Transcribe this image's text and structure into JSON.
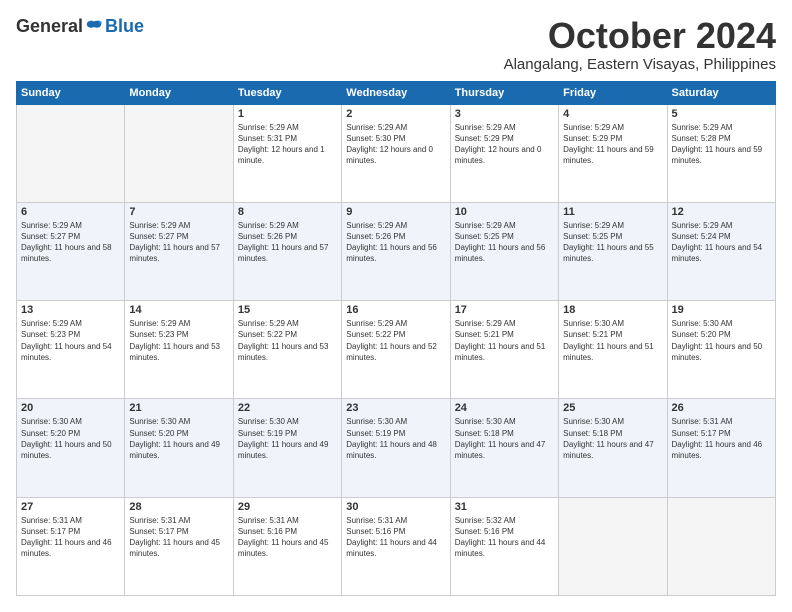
{
  "logo": {
    "general": "General",
    "blue": "Blue"
  },
  "header": {
    "month": "October 2024",
    "location": "Alangalang, Eastern Visayas, Philippines"
  },
  "weekdays": [
    "Sunday",
    "Monday",
    "Tuesday",
    "Wednesday",
    "Thursday",
    "Friday",
    "Saturday"
  ],
  "weeks": [
    [
      {
        "day": "",
        "empty": true
      },
      {
        "day": "",
        "empty": true
      },
      {
        "day": "1",
        "sunrise": "Sunrise: 5:29 AM",
        "sunset": "Sunset: 5:31 PM",
        "daylight": "Daylight: 12 hours and 1 minute."
      },
      {
        "day": "2",
        "sunrise": "Sunrise: 5:29 AM",
        "sunset": "Sunset: 5:30 PM",
        "daylight": "Daylight: 12 hours and 0 minutes."
      },
      {
        "day": "3",
        "sunrise": "Sunrise: 5:29 AM",
        "sunset": "Sunset: 5:29 PM",
        "daylight": "Daylight: 12 hours and 0 minutes."
      },
      {
        "day": "4",
        "sunrise": "Sunrise: 5:29 AM",
        "sunset": "Sunset: 5:29 PM",
        "daylight": "Daylight: 11 hours and 59 minutes."
      },
      {
        "day": "5",
        "sunrise": "Sunrise: 5:29 AM",
        "sunset": "Sunset: 5:28 PM",
        "daylight": "Daylight: 11 hours and 59 minutes."
      }
    ],
    [
      {
        "day": "6",
        "sunrise": "Sunrise: 5:29 AM",
        "sunset": "Sunset: 5:27 PM",
        "daylight": "Daylight: 11 hours and 58 minutes."
      },
      {
        "day": "7",
        "sunrise": "Sunrise: 5:29 AM",
        "sunset": "Sunset: 5:27 PM",
        "daylight": "Daylight: 11 hours and 57 minutes."
      },
      {
        "day": "8",
        "sunrise": "Sunrise: 5:29 AM",
        "sunset": "Sunset: 5:26 PM",
        "daylight": "Daylight: 11 hours and 57 minutes."
      },
      {
        "day": "9",
        "sunrise": "Sunrise: 5:29 AM",
        "sunset": "Sunset: 5:26 PM",
        "daylight": "Daylight: 11 hours and 56 minutes."
      },
      {
        "day": "10",
        "sunrise": "Sunrise: 5:29 AM",
        "sunset": "Sunset: 5:25 PM",
        "daylight": "Daylight: 11 hours and 56 minutes."
      },
      {
        "day": "11",
        "sunrise": "Sunrise: 5:29 AM",
        "sunset": "Sunset: 5:25 PM",
        "daylight": "Daylight: 11 hours and 55 minutes."
      },
      {
        "day": "12",
        "sunrise": "Sunrise: 5:29 AM",
        "sunset": "Sunset: 5:24 PM",
        "daylight": "Daylight: 11 hours and 54 minutes."
      }
    ],
    [
      {
        "day": "13",
        "sunrise": "Sunrise: 5:29 AM",
        "sunset": "Sunset: 5:23 PM",
        "daylight": "Daylight: 11 hours and 54 minutes."
      },
      {
        "day": "14",
        "sunrise": "Sunrise: 5:29 AM",
        "sunset": "Sunset: 5:23 PM",
        "daylight": "Daylight: 11 hours and 53 minutes."
      },
      {
        "day": "15",
        "sunrise": "Sunrise: 5:29 AM",
        "sunset": "Sunset: 5:22 PM",
        "daylight": "Daylight: 11 hours and 53 minutes."
      },
      {
        "day": "16",
        "sunrise": "Sunrise: 5:29 AM",
        "sunset": "Sunset: 5:22 PM",
        "daylight": "Daylight: 11 hours and 52 minutes."
      },
      {
        "day": "17",
        "sunrise": "Sunrise: 5:29 AM",
        "sunset": "Sunset: 5:21 PM",
        "daylight": "Daylight: 11 hours and 51 minutes."
      },
      {
        "day": "18",
        "sunrise": "Sunrise: 5:30 AM",
        "sunset": "Sunset: 5:21 PM",
        "daylight": "Daylight: 11 hours and 51 minutes."
      },
      {
        "day": "19",
        "sunrise": "Sunrise: 5:30 AM",
        "sunset": "Sunset: 5:20 PM",
        "daylight": "Daylight: 11 hours and 50 minutes."
      }
    ],
    [
      {
        "day": "20",
        "sunrise": "Sunrise: 5:30 AM",
        "sunset": "Sunset: 5:20 PM",
        "daylight": "Daylight: 11 hours and 50 minutes."
      },
      {
        "day": "21",
        "sunrise": "Sunrise: 5:30 AM",
        "sunset": "Sunset: 5:20 PM",
        "daylight": "Daylight: 11 hours and 49 minutes."
      },
      {
        "day": "22",
        "sunrise": "Sunrise: 5:30 AM",
        "sunset": "Sunset: 5:19 PM",
        "daylight": "Daylight: 11 hours and 49 minutes."
      },
      {
        "day": "23",
        "sunrise": "Sunrise: 5:30 AM",
        "sunset": "Sunset: 5:19 PM",
        "daylight": "Daylight: 11 hours and 48 minutes."
      },
      {
        "day": "24",
        "sunrise": "Sunrise: 5:30 AM",
        "sunset": "Sunset: 5:18 PM",
        "daylight": "Daylight: 11 hours and 47 minutes."
      },
      {
        "day": "25",
        "sunrise": "Sunrise: 5:30 AM",
        "sunset": "Sunset: 5:18 PM",
        "daylight": "Daylight: 11 hours and 47 minutes."
      },
      {
        "day": "26",
        "sunrise": "Sunrise: 5:31 AM",
        "sunset": "Sunset: 5:17 PM",
        "daylight": "Daylight: 11 hours and 46 minutes."
      }
    ],
    [
      {
        "day": "27",
        "sunrise": "Sunrise: 5:31 AM",
        "sunset": "Sunset: 5:17 PM",
        "daylight": "Daylight: 11 hours and 46 minutes."
      },
      {
        "day": "28",
        "sunrise": "Sunrise: 5:31 AM",
        "sunset": "Sunset: 5:17 PM",
        "daylight": "Daylight: 11 hours and 45 minutes."
      },
      {
        "day": "29",
        "sunrise": "Sunrise: 5:31 AM",
        "sunset": "Sunset: 5:16 PM",
        "daylight": "Daylight: 11 hours and 45 minutes."
      },
      {
        "day": "30",
        "sunrise": "Sunrise: 5:31 AM",
        "sunset": "Sunset: 5:16 PM",
        "daylight": "Daylight: 11 hours and 44 minutes."
      },
      {
        "day": "31",
        "sunrise": "Sunrise: 5:32 AM",
        "sunset": "Sunset: 5:16 PM",
        "daylight": "Daylight: 11 hours and 44 minutes."
      },
      {
        "day": "",
        "empty": true
      },
      {
        "day": "",
        "empty": true
      }
    ]
  ]
}
